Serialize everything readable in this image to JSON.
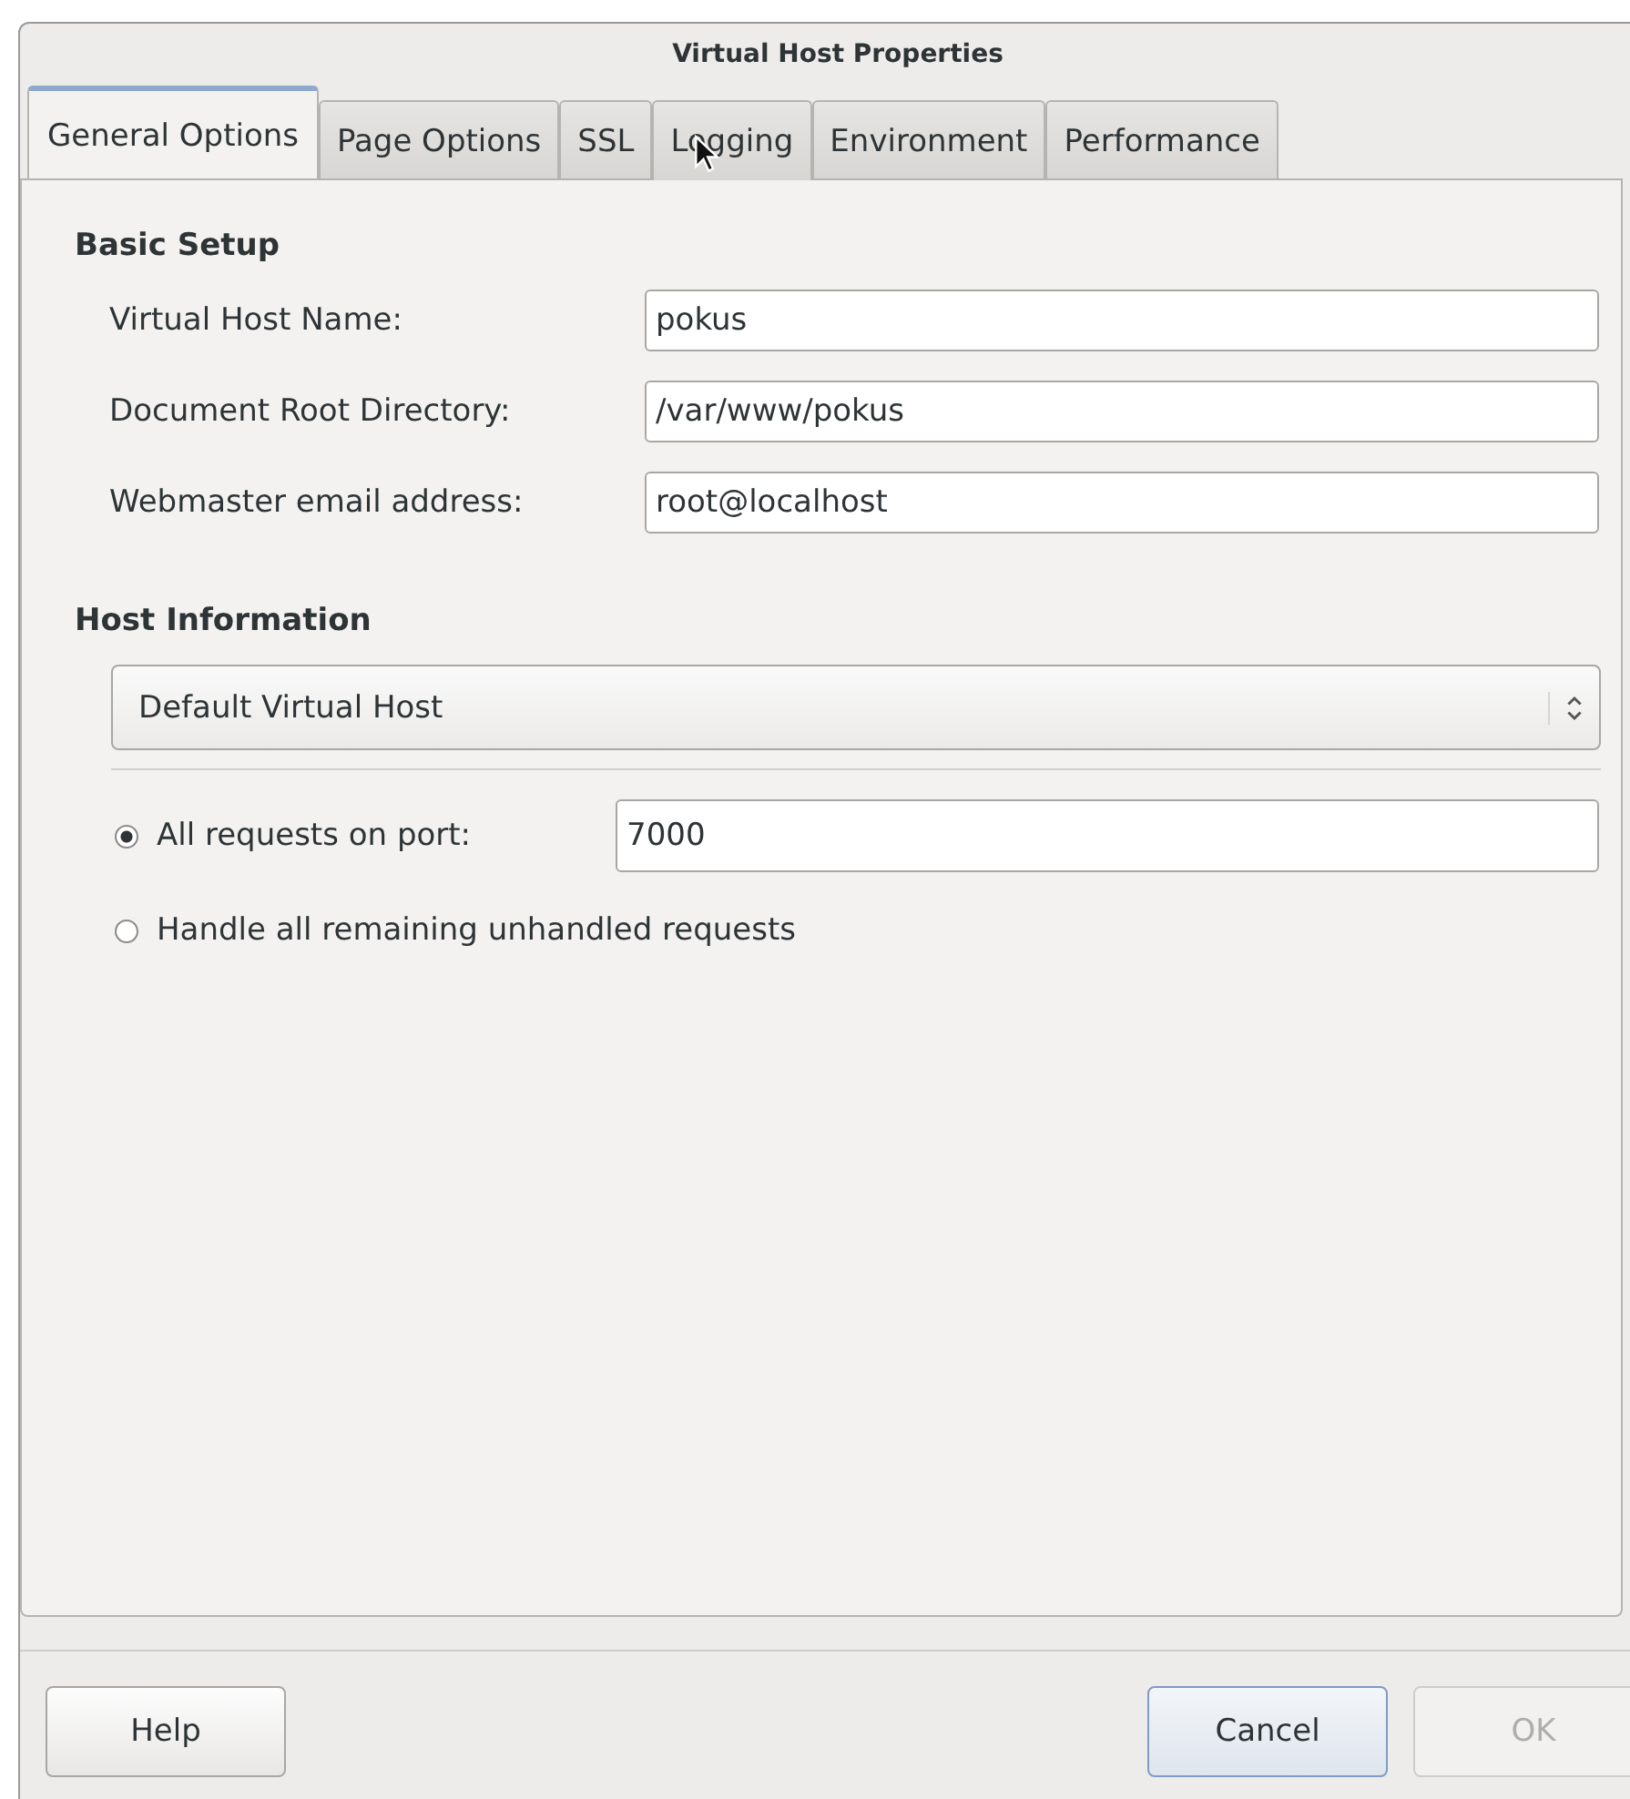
{
  "window": {
    "title": "Virtual Host Properties"
  },
  "tabs": [
    {
      "label": "General Options",
      "selected": true
    },
    {
      "label": "Page Options",
      "selected": false
    },
    {
      "label": "SSL",
      "selected": false
    },
    {
      "label": "Logging",
      "selected": false
    },
    {
      "label": "Environment",
      "selected": false
    },
    {
      "label": "Performance",
      "selected": false
    }
  ],
  "basic_setup": {
    "heading": "Basic Setup",
    "fields": [
      {
        "label": "Virtual Host Name:",
        "value": "pokus"
      },
      {
        "label": "Document Root Directory:",
        "value": "/var/www/pokus"
      },
      {
        "label": "Webmaster email address:",
        "value": "root@localhost"
      }
    ]
  },
  "host_information": {
    "heading": "Host Information",
    "dropdown": {
      "value": "Default Virtual Host"
    },
    "options": [
      {
        "label": "All requests on port:",
        "selected": true,
        "value": "7000"
      },
      {
        "label": "Handle all remaining unhandled requests",
        "selected": false
      }
    ]
  },
  "buttons": [
    {
      "label": "Help",
      "kind": "left",
      "disabled": false,
      "focused": false
    },
    {
      "label": "Cancel",
      "kind": "right",
      "disabled": false,
      "focused": true
    },
    {
      "label": "OK",
      "kind": "right",
      "disabled": true,
      "focused": false
    }
  ]
}
